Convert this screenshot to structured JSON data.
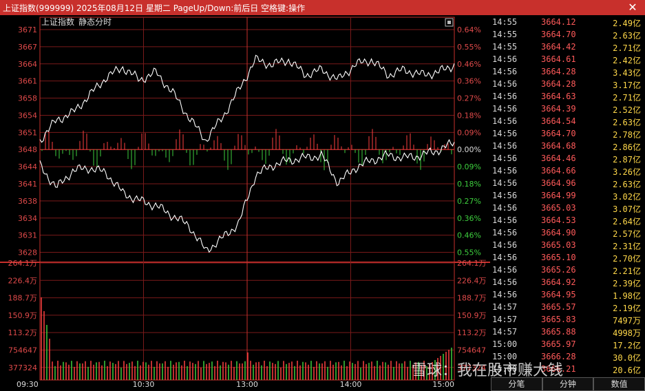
{
  "window": {
    "title": "上证指数(999999) 2025年08月12日 星期二 PageUp/Down:前后日 空格键:操作",
    "close_glyph": "✕"
  },
  "chart": {
    "title": "上证指数",
    "mode": "静态分时",
    "base_price": 3648,
    "price_labels": [
      "3671",
      "3667",
      "3664",
      "3661",
      "3658",
      "3654",
      "3651",
      "3648",
      "3644",
      "3641",
      "3638",
      "3634",
      "3631",
      "3628"
    ],
    "pct_labels": [
      "0.64%",
      "0.55%",
      "0.46%",
      "0.36%",
      "0.27%",
      "0.18%",
      "0.09%",
      "0.00%",
      "0.09%",
      "0.18%",
      "0.27%",
      "0.36%",
      "0.46%",
      "0.55%"
    ],
    "volume_labels_left": [
      "264.1万",
      "226.4万",
      "188.7万",
      "150.9万",
      "113.2万",
      "754647",
      "377324"
    ],
    "volume_labels_right": [
      "264.1万",
      "226.4万",
      "188.7万",
      "150.9万",
      "113.2万",
      "754647",
      "377324"
    ],
    "time_labels": [
      "09:30",
      "10:30",
      "13:00",
      "14:00",
      "15:00"
    ],
    "colors": {
      "up": "#ff4040",
      "down": "#3ecf3e",
      "grid": "#7a1a1a",
      "frame": "#c8302c",
      "line": "#ffffff"
    }
  },
  "chart_data": {
    "type": "line",
    "x": [
      "09:30",
      "09:40",
      "09:50",
      "10:00",
      "10:10",
      "10:20",
      "10:30",
      "10:40",
      "10:50",
      "11:00",
      "11:10",
      "11:20",
      "11:30",
      "13:00",
      "13:10",
      "13:20",
      "13:30",
      "13:40",
      "13:50",
      "14:00",
      "14:10",
      "14:20",
      "14:30",
      "14:40",
      "14:50",
      "15:00"
    ],
    "series": [
      {
        "values": [
          3645.5,
          3641.0,
          3644.5,
          3645.0,
          3644.0,
          3640.0,
          3638.5,
          3637.5,
          3635.5,
          3633.5,
          3628.5,
          3631.0,
          3634.0,
          3643.5,
          3645.5,
          3646.5,
          3647.0,
          3647.5,
          3642.0,
          3645.0,
          3646.5,
          3647.5,
          3647.0,
          3647.5,
          3648.5,
          3650.0
        ]
      },
      {
        "values": [
          3650.5,
          3654.5,
          3656.0,
          3659.5,
          3663.0,
          3665.0,
          3662.5,
          3664.0,
          3660.0,
          3655.0,
          3650.5,
          3655.0,
          3660.5,
          3666.5,
          3665.5,
          3666.5,
          3663.5,
          3664.5,
          3662.5,
          3665.5,
          3666.5,
          3663.5,
          3664.5,
          3663.5,
          3664.0,
          3665.5
        ]
      }
    ],
    "ylim": [
      3626.5,
      3672.5
    ]
  },
  "ticks": [
    {
      "time": "14:55",
      "price": "3664.12",
      "vol": "2.49亿"
    },
    {
      "time": "14:55",
      "price": "3664.70",
      "vol": "2.63亿"
    },
    {
      "time": "14:55",
      "price": "3664.42",
      "vol": "2.71亿"
    },
    {
      "time": "14:56",
      "price": "3664.61",
      "vol": "2.42亿"
    },
    {
      "time": "14:56",
      "price": "3664.28",
      "vol": "3.43亿"
    },
    {
      "time": "14:56",
      "price": "3664.28",
      "vol": "3.17亿"
    },
    {
      "time": "14:56",
      "price": "3664.63",
      "vol": "2.71亿"
    },
    {
      "time": "14:56",
      "price": "3664.39",
      "vol": "2.52亿"
    },
    {
      "time": "14:56",
      "price": "3664.54",
      "vol": "2.63亿"
    },
    {
      "time": "14:56",
      "price": "3664.70",
      "vol": "2.78亿"
    },
    {
      "time": "14:56",
      "price": "3664.68",
      "vol": "2.86亿"
    },
    {
      "time": "14:56",
      "price": "3664.46",
      "vol": "2.87亿"
    },
    {
      "time": "14:56",
      "price": "3664.66",
      "vol": "3.26亿"
    },
    {
      "time": "14:56",
      "price": "3664.96",
      "vol": "2.63亿"
    },
    {
      "time": "14:56",
      "price": "3664.99",
      "vol": "3.02亿"
    },
    {
      "time": "14:56",
      "price": "3665.03",
      "vol": "3.07亿"
    },
    {
      "time": "14:56",
      "price": "3664.53",
      "vol": "2.64亿"
    },
    {
      "time": "14:56",
      "price": "3664.90",
      "vol": "2.57亿"
    },
    {
      "time": "14:56",
      "price": "3665.03",
      "vol": "2.31亿"
    },
    {
      "time": "14:56",
      "price": "3665.10",
      "vol": "2.70亿"
    },
    {
      "time": "14:56",
      "price": "3665.26",
      "vol": "2.21亿"
    },
    {
      "time": "14:56",
      "price": "3664.92",
      "vol": "2.39亿"
    },
    {
      "time": "14:56",
      "price": "3664.95",
      "vol": "1.98亿"
    },
    {
      "time": "14:57",
      "price": "3665.57",
      "vol": "2.19亿"
    },
    {
      "time": "14:57",
      "price": "3665.83",
      "vol": "7497万"
    },
    {
      "time": "14:57",
      "price": "3665.88",
      "vol": "4998万"
    },
    {
      "time": "15:00",
      "price": "3665.97",
      "vol": "17.2亿"
    },
    {
      "time": "15:00",
      "price": "3666.28",
      "vol": "30.0亿"
    },
    {
      "time": "15:00",
      "price": "3666.21",
      "vol": "20.6亿"
    }
  ],
  "tabs": [
    "分笔",
    "分钟",
    "数值"
  ],
  "watermark": "雪球：我在股市赚大钱"
}
